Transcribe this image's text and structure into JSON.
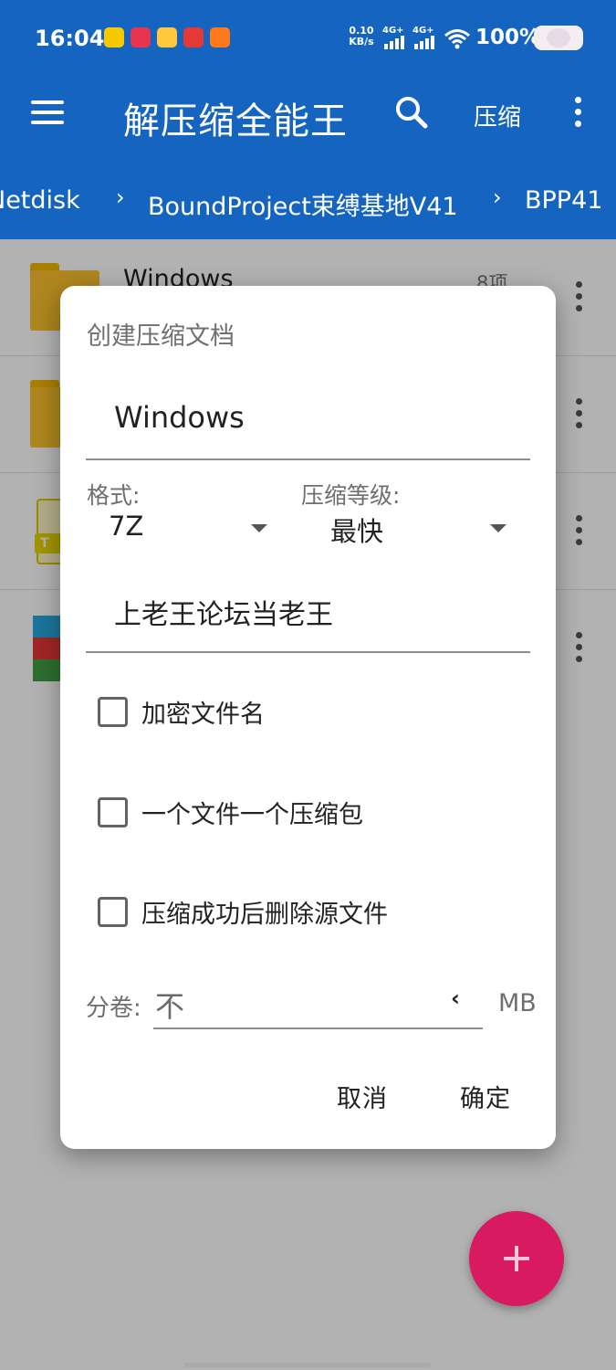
{
  "status": {
    "time": "16:04",
    "net_speed_value": "0.10",
    "net_speed_unit": "KB/s",
    "signal1": "4G+",
    "signal2": "4G+",
    "battery": "100%"
  },
  "appbar": {
    "title": "解压缩全能王",
    "compress_label": "压缩",
    "icons": [
      "menu-icon",
      "search-icon",
      "more-vert-icon"
    ]
  },
  "breadcrumb": [
    "Netdisk",
    "BoundProject束缚基地V41",
    "BPP41"
  ],
  "files": [
    {
      "name": "Windows",
      "count": "8项"
    }
  ],
  "dialog": {
    "title": "创建压缩文档",
    "filename": "Windows",
    "format_label": "格式:",
    "format_value": "7Z",
    "level_label": "压缩等级:",
    "level_value": "最快",
    "password": "上老王论坛当老王",
    "options": [
      {
        "label": "加密文件名",
        "checked": false
      },
      {
        "label": "一个文件一个压缩包",
        "checked": false
      },
      {
        "label": "压缩成功后删除源文件",
        "checked": false
      }
    ],
    "volume_label": "分卷:",
    "volume_value": "不",
    "volume_unit": "MB",
    "cancel_label": "取消",
    "ok_label": "确定"
  },
  "colors": {
    "appbar": "#1565c0",
    "fab": "#d81b60",
    "folder": "#fbc02d"
  }
}
